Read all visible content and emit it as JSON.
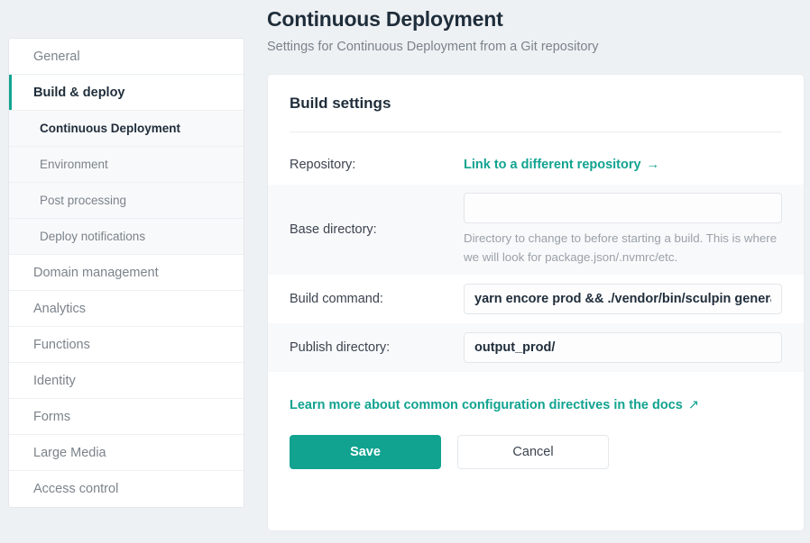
{
  "header": {
    "title": "Continuous Deployment",
    "subtitle": "Settings for Continuous Deployment from a Git repository"
  },
  "sidebar": {
    "items": [
      {
        "label": "General"
      },
      {
        "label": "Build & deploy"
      },
      {
        "label": "Continuous Deployment"
      },
      {
        "label": "Environment"
      },
      {
        "label": "Post processing"
      },
      {
        "label": "Deploy notifications"
      },
      {
        "label": "Domain management"
      },
      {
        "label": "Analytics"
      },
      {
        "label": "Functions"
      },
      {
        "label": "Identity"
      },
      {
        "label": "Forms"
      },
      {
        "label": "Large Media"
      },
      {
        "label": "Access control"
      }
    ]
  },
  "card": {
    "title": "Build settings",
    "repository": {
      "label": "Repository:",
      "link_label": "Link to a different repository",
      "link_arrow": "→"
    },
    "base_directory": {
      "label": "Base directory:",
      "value": "",
      "placeholder": "",
      "help": "Directory to change to before starting a build. This is where we will look for package.json/.nvmrc/etc."
    },
    "build_command": {
      "label": "Build command:",
      "value": "yarn encore prod && ./vendor/bin/sculpin generate",
      "placeholder": ""
    },
    "publish_directory": {
      "label": "Publish directory:",
      "value": "output_prod/",
      "placeholder": ""
    },
    "docs_link": {
      "label": "Learn more about common configuration directives in the docs",
      "arrow": "↗"
    },
    "buttons": {
      "save": "Save",
      "cancel": "Cancel"
    }
  },
  "colors": {
    "accent": "#11a390",
    "page_bg": "#eef1f4",
    "text_dark": "#1f2d3a",
    "text_muted": "#7b838b"
  }
}
